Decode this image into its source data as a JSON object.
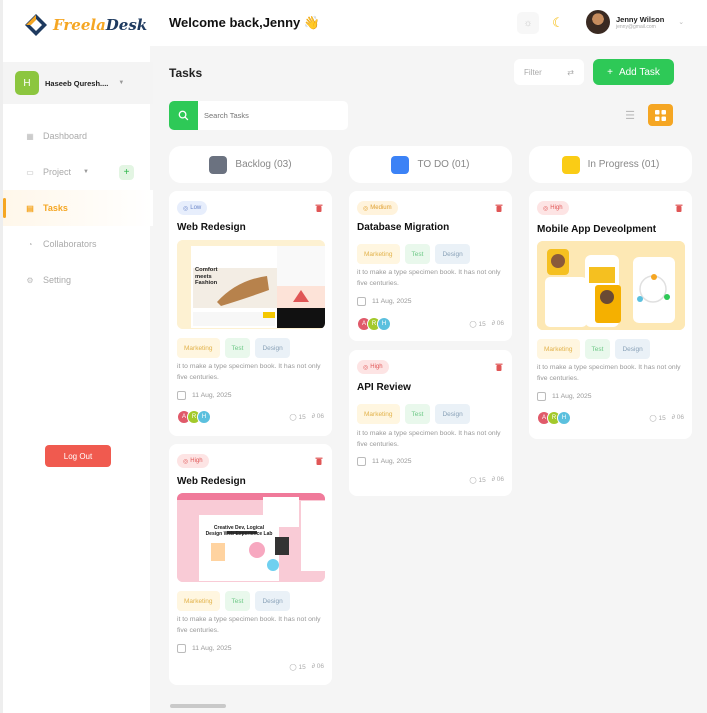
{
  "brand": {
    "part1": "Freela",
    "part2": "Desk"
  },
  "user_chip": {
    "initial": "H",
    "name": "Haseeb Quresh...."
  },
  "nav": [
    {
      "label": "Dashboard",
      "icon": "grid-icon"
    },
    {
      "label": "Project",
      "icon": "folder-icon"
    },
    {
      "label": "Tasks",
      "icon": "tasks-icon"
    },
    {
      "label": "Collaborators",
      "icon": "users-icon"
    },
    {
      "label": "Setting",
      "icon": "gear-icon"
    }
  ],
  "logout_label": "Log Out",
  "header": {
    "welcome": "Welcome back,Jenny 👋",
    "profile_name": "Jenny Wilson",
    "profile_email": "jenny@gmail.com"
  },
  "page": {
    "title": "Tasks",
    "filter_label": "Filter",
    "add_task_label": "Add Task",
    "search_placeholder": "Search Tasks"
  },
  "columns": [
    {
      "title": "Backlog (03)",
      "color": "#6b7280"
    },
    {
      "title": "TO DO (01)",
      "color": "#3b82f6"
    },
    {
      "title": "In Progress (01)",
      "color": "#facc15"
    }
  ],
  "cards": [
    {
      "priority": "Low",
      "title": "Web Redesign",
      "tags": [
        "Marketing",
        "Test",
        "Design"
      ],
      "description": "it to make a type specimen book. It has not only five centuries.",
      "date": "11 Aug, 2025",
      "assignees": [
        "A",
        "R",
        "H"
      ],
      "comments": "15",
      "attachments": "06"
    },
    {
      "priority": "High",
      "title": "Web Redesign",
      "tags": [
        "Marketing",
        "Test",
        "Design"
      ],
      "description": "it to make a type specimen book. It has not only five centuries.",
      "date": "11 Aug, 2025",
      "assignees": [],
      "comments": "15",
      "attachments": "06"
    },
    {
      "priority": "Medium",
      "title": "Database Migration",
      "tags": [
        "Marketing",
        "Test",
        "Design"
      ],
      "description": "it to make a type specimen book. It has not only five centuries.",
      "date": "11 Aug, 2025",
      "assignees": [
        "A",
        "R",
        "H"
      ],
      "comments": "15",
      "attachments": "06"
    },
    {
      "priority": "High",
      "title": "API Review",
      "tags": [
        "Marketing",
        "Test",
        "Design"
      ],
      "description": "it to make a type specimen book. It has not only five centuries.",
      "date": "11 Aug, 2025",
      "assignees": [],
      "comments": "15",
      "attachments": "06"
    },
    {
      "priority": "High",
      "title": "Mobile App Deveolpment",
      "tags": [
        "Marketing",
        "Test",
        "Design"
      ],
      "description": "it to make a type specimen book. It has not only five centuries.",
      "date": "11 Aug, 2025",
      "assignees": [
        "A",
        "R",
        "H"
      ],
      "comments": "15",
      "attachments": "06"
    }
  ],
  "thumb_text": {
    "shoe_headline": "Comfort meets Fashion",
    "landing_headline": "Creative Dev, Logical Design Web Experience Lab"
  }
}
